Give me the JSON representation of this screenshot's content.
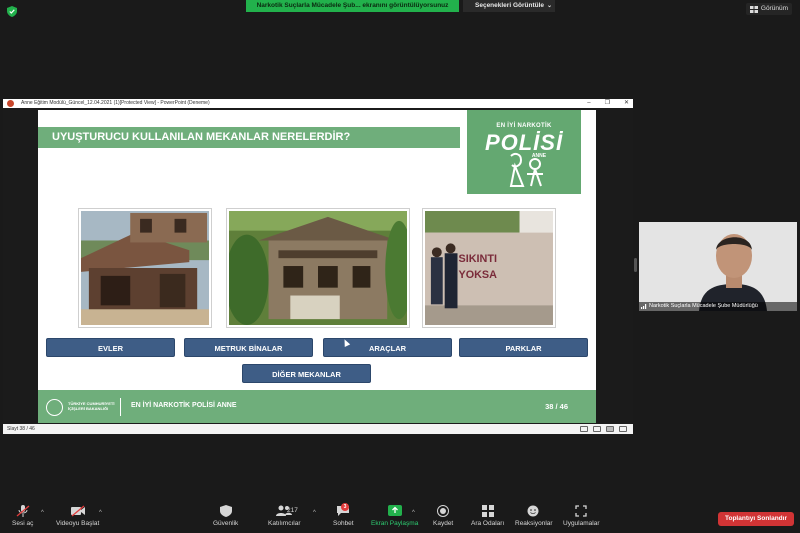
{
  "top_bar": {
    "share_banner": "Narkotik Suçlarla Mücadele Şub... ekranını görüntülüyorsunuz",
    "view_options": "Seçenekleri Görüntüle",
    "view_button": "Görünüm"
  },
  "ppt": {
    "window_title": "Anne Eğitim Modülü_Güncel_12.04.2021 (1)[Protected View] - PowerPoint (Deneme)",
    "status_text": "Slayt 38 / 46"
  },
  "slide": {
    "title": "UYUŞTURUCU KULLANILAN MEKANLAR NERELERDİR?",
    "logo_top": "EN İYİ NARKOTİK",
    "logo_big": "POLİSİ",
    "logo_anne": "ANNE",
    "buttons": [
      "EVLER",
      "METRUK BİNALAR",
      "ARAÇLAR",
      "PARKLAR",
      "DİĞER MEKANLAR"
    ],
    "footer_ministry_line1": "TÜRKİYE CUMHURİYETİ",
    "footer_ministry_line2": "İÇİŞLERİ BAKANLIĞI",
    "footer_title": "EN İYİ NARKOTİK POLİSİ ANNE",
    "slide_number": "38 / 46",
    "graffiti_line1": "SIKINTI",
    "graffiti_line2": "YOKSA"
  },
  "participant": {
    "name": "Narkotik Suçlarla Mücadele Şube Müdürlüğü"
  },
  "toolbar": {
    "audio": "Sesi aç",
    "video": "Videoyu Başlat",
    "security": "Güvenlik",
    "participants": "Katılımcılar",
    "participants_count": "217",
    "chat": "Sohbet",
    "chat_badge": "3",
    "share": "Ekran Paylaşma",
    "record": "Kaydet",
    "breakout": "Ara Odaları",
    "reactions": "Reaksiyonlar",
    "apps": "Uygulamalar",
    "end": "Toplantıyı Sonlandır"
  },
  "colors": {
    "slide_green": "#6fae7b",
    "button_blue": "#3e5d86",
    "share_green": "#22b14c",
    "end_red": "#d13435"
  }
}
